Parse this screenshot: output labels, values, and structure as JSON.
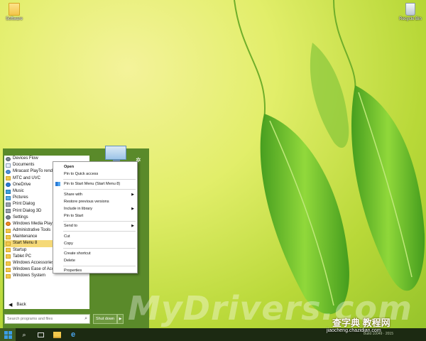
{
  "desktop": {
    "folder_label": "Software",
    "recycle_label": "Recycle Bin"
  },
  "start_menu": {
    "items": [
      {
        "label": "Devices Flow",
        "icon": "gear-icon",
        "highlight": false
      },
      {
        "label": "Documents",
        "icon": "document-icon",
        "highlight": false
      },
      {
        "label": "Miracast PlayTo render",
        "icon": "cast-icon",
        "highlight": false
      },
      {
        "label": "MTC and UVC",
        "icon": "folder-icon",
        "highlight": false
      },
      {
        "label": "OneDrive",
        "icon": "cloud-icon",
        "highlight": false
      },
      {
        "label": "Music",
        "icon": "music-icon",
        "highlight": false
      },
      {
        "label": "Pictures",
        "icon": "picture-icon",
        "highlight": false
      },
      {
        "label": "Print Dialog",
        "icon": "printer-icon",
        "highlight": false
      },
      {
        "label": "Print Dialog 3D",
        "icon": "printer-icon",
        "highlight": false
      },
      {
        "label": "Settings",
        "icon": "settings-icon",
        "highlight": false
      },
      {
        "label": "Windows Media Player",
        "icon": "media-player-icon",
        "highlight": false
      },
      {
        "label": "Administrative Tools",
        "icon": "folder-icon",
        "highlight": false
      },
      {
        "label": "Maintenance",
        "icon": "folder-icon",
        "highlight": false
      },
      {
        "label": "Start Menu 8",
        "icon": "folder-icon",
        "highlight": true
      },
      {
        "label": "Startup",
        "icon": "folder-icon",
        "highlight": false
      },
      {
        "label": "Tablet PC",
        "icon": "folder-icon",
        "highlight": false
      },
      {
        "label": "Windows Accessories",
        "icon": "folder-icon",
        "highlight": false
      },
      {
        "label": "Windows Ease of Access",
        "icon": "folder-icon",
        "highlight": false
      },
      {
        "label": "Windows System",
        "icon": "folder-icon",
        "highlight": false
      }
    ],
    "back_label": "Back",
    "search_placeholder": "Search programs and files",
    "shutdown_label": "Shut down"
  },
  "context_menu": {
    "items": [
      {
        "type": "item",
        "label": "Open",
        "bold": true
      },
      {
        "type": "item",
        "label": "Pin to Quick access"
      },
      {
        "type": "separator"
      },
      {
        "type": "item",
        "label": "Pin to Start Menu (Start Menu 8)",
        "shield": true
      },
      {
        "type": "separator"
      },
      {
        "type": "item",
        "label": "Share with",
        "submenu": true
      },
      {
        "type": "item",
        "label": "Restore previous versions"
      },
      {
        "type": "item",
        "label": "Include in library",
        "submenu": true
      },
      {
        "type": "item",
        "label": "Pin to Start"
      },
      {
        "type": "separator"
      },
      {
        "type": "item",
        "label": "Send to",
        "submenu": true
      },
      {
        "type": "separator"
      },
      {
        "type": "item",
        "label": "Cut"
      },
      {
        "type": "item",
        "label": "Copy"
      },
      {
        "type": "separator"
      },
      {
        "type": "item",
        "label": "Create shortcut"
      },
      {
        "type": "item",
        "label": "Delete"
      },
      {
        "type": "separator"
      },
      {
        "type": "item",
        "label": "Properties"
      }
    ]
  },
  "taskbar": {
    "tray_text": "Build 10049 · 2015"
  },
  "watermarks": {
    "main": "MyDrivers.com",
    "site_cn": "查字典 教程网",
    "site_url": "jiaocheng.chazidian.com"
  }
}
